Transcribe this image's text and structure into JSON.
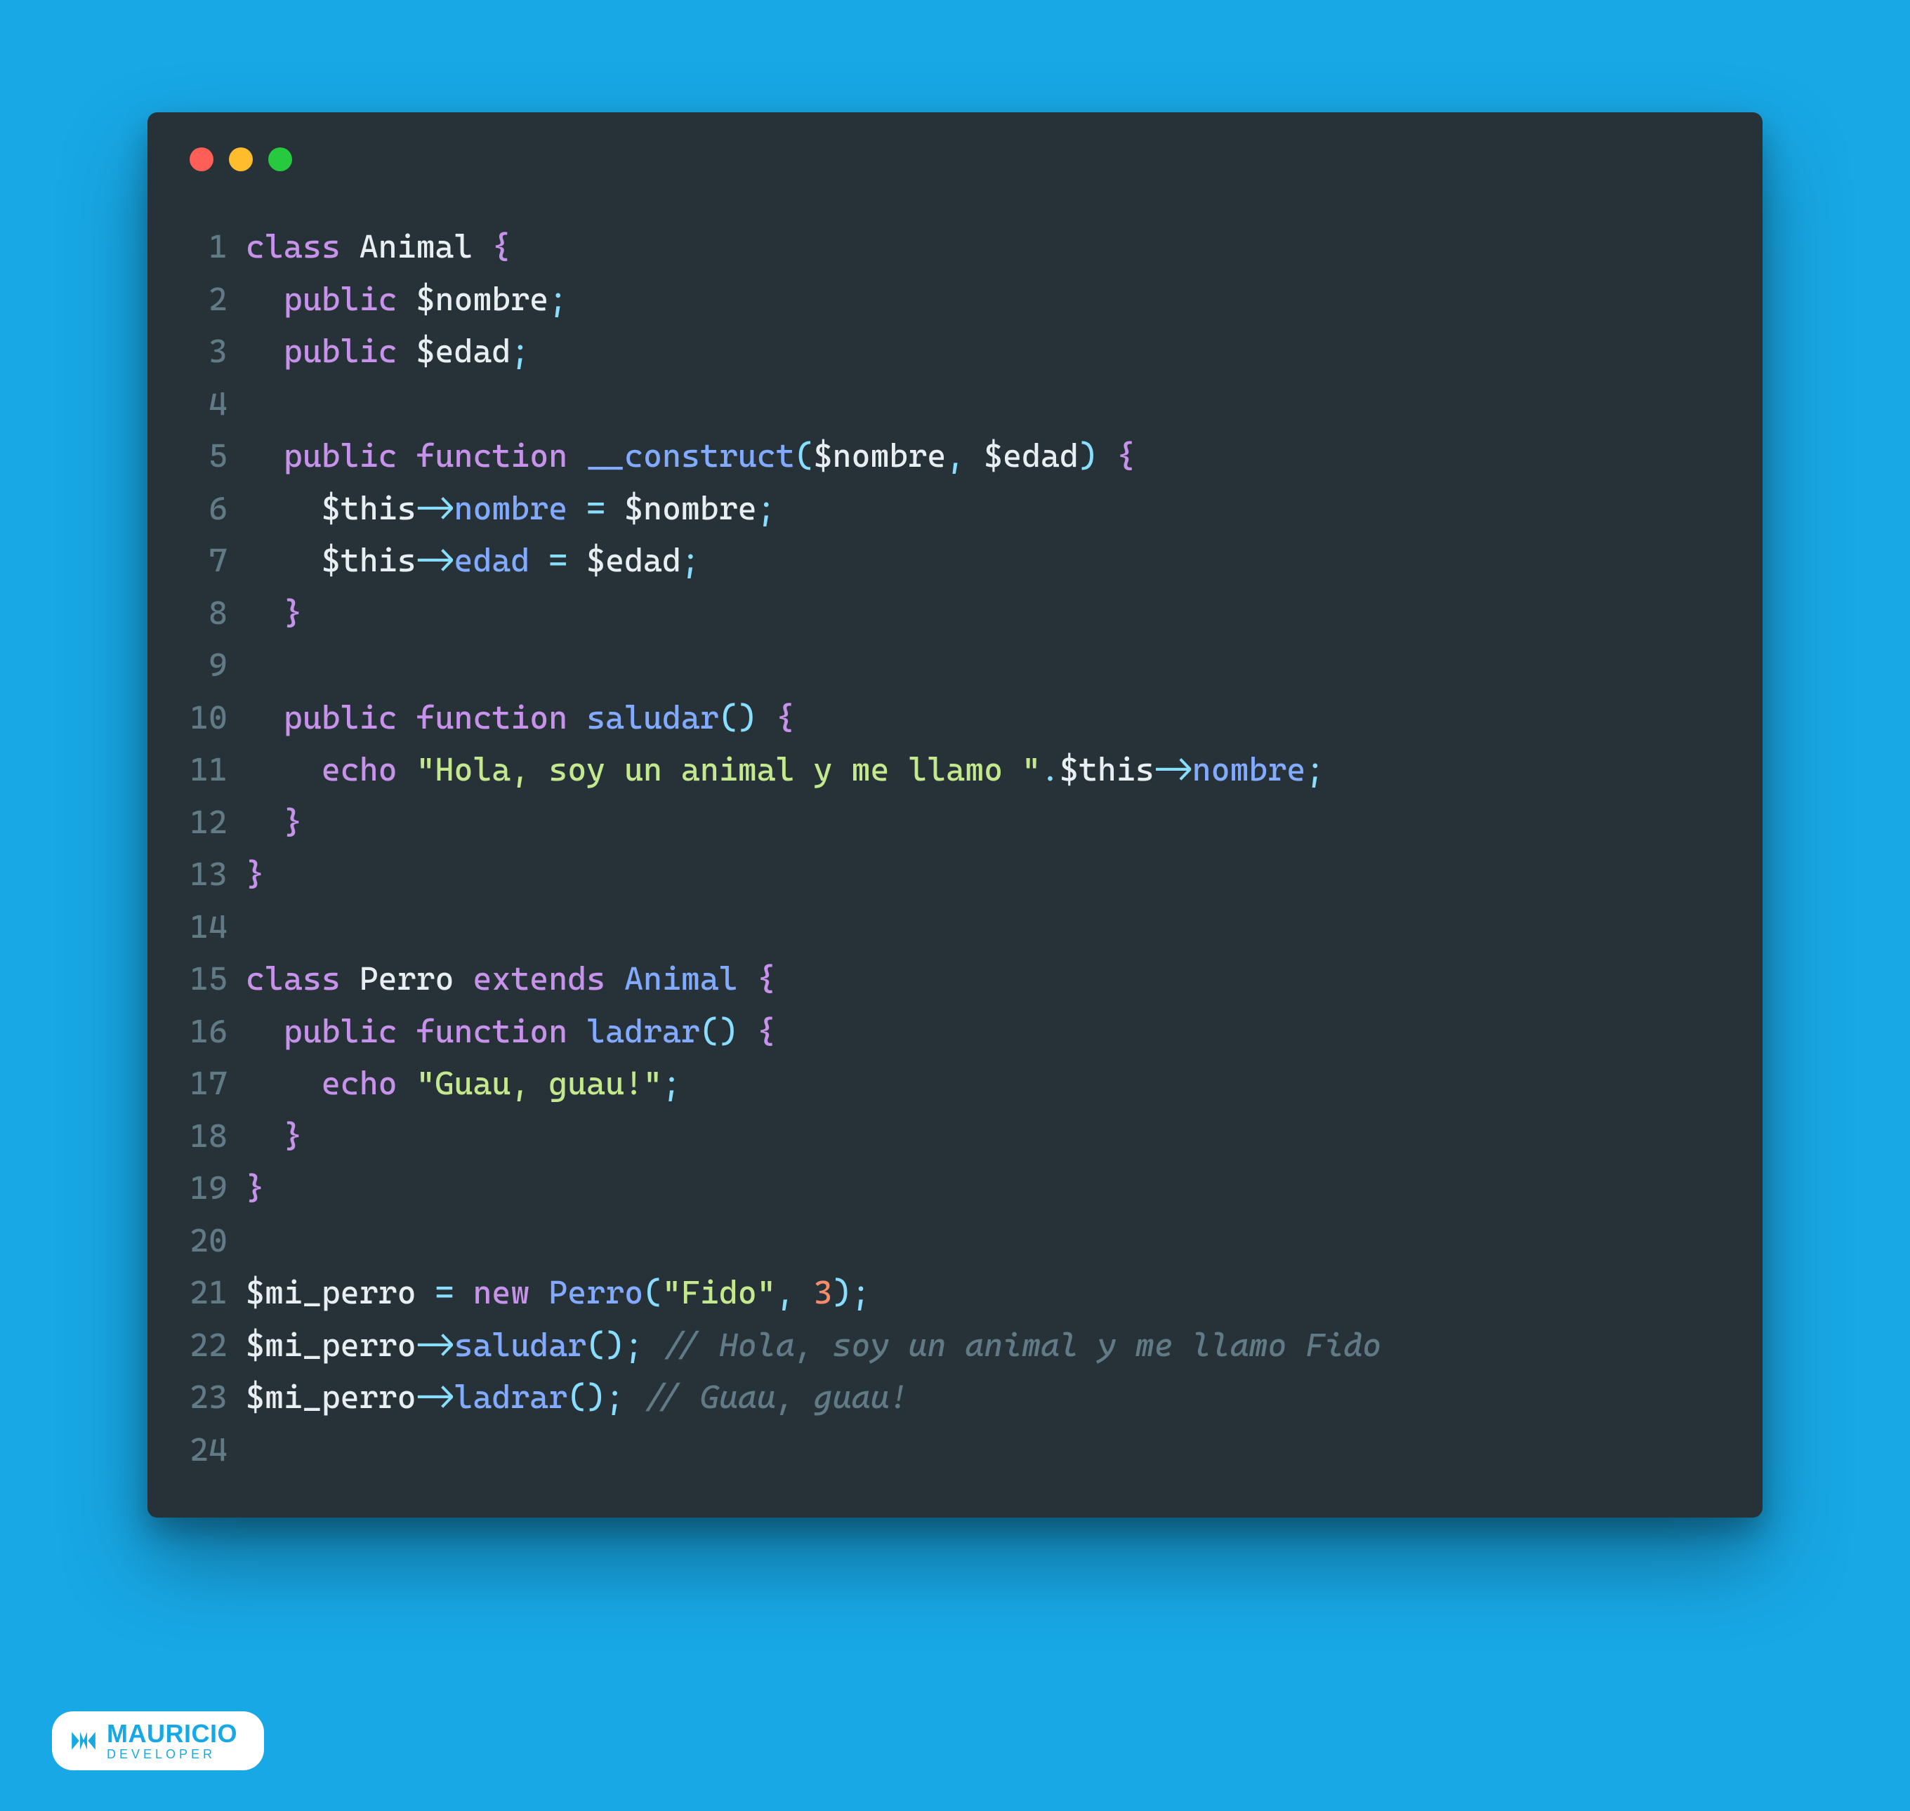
{
  "colors": {
    "bg": "#18a8e6",
    "editor_bg": "#263238"
  },
  "window": {
    "buttons": [
      "close",
      "minimize",
      "maximize"
    ]
  },
  "code": {
    "lines": [
      {
        "n": 1,
        "tokens": [
          [
            "kw",
            "class"
          ],
          [
            "sp",
            " "
          ],
          [
            "cls",
            "Animal"
          ],
          [
            "sp",
            " "
          ],
          [
            "brace",
            "{"
          ]
        ]
      },
      {
        "n": 2,
        "tokens": [
          [
            "sp",
            "  "
          ],
          [
            "kw",
            "public"
          ],
          [
            "sp",
            " "
          ],
          [
            "var",
            "$nombre"
          ],
          [
            "op",
            ";"
          ]
        ]
      },
      {
        "n": 3,
        "tokens": [
          [
            "sp",
            "  "
          ],
          [
            "kw",
            "public"
          ],
          [
            "sp",
            " "
          ],
          [
            "var",
            "$edad"
          ],
          [
            "op",
            ";"
          ]
        ]
      },
      {
        "n": 4,
        "tokens": []
      },
      {
        "n": 5,
        "tokens": [
          [
            "sp",
            "  "
          ],
          [
            "kw",
            "public"
          ],
          [
            "sp",
            " "
          ],
          [
            "kw",
            "function"
          ],
          [
            "sp",
            " "
          ],
          [
            "fn",
            "__construct"
          ],
          [
            "punc",
            "("
          ],
          [
            "var",
            "$nombre"
          ],
          [
            "op",
            ","
          ],
          [
            "sp",
            " "
          ],
          [
            "var",
            "$edad"
          ],
          [
            "punc",
            ")"
          ],
          [
            "sp",
            " "
          ],
          [
            "brace",
            "{"
          ]
        ]
      },
      {
        "n": 6,
        "tokens": [
          [
            "sp",
            "    "
          ],
          [
            "this",
            "$this"
          ],
          [
            "op",
            "->"
          ],
          [
            "prop",
            "nombre"
          ],
          [
            "sp",
            " "
          ],
          [
            "op",
            "="
          ],
          [
            "sp",
            " "
          ],
          [
            "var",
            "$nombre"
          ],
          [
            "op",
            ";"
          ]
        ]
      },
      {
        "n": 7,
        "tokens": [
          [
            "sp",
            "    "
          ],
          [
            "this",
            "$this"
          ],
          [
            "op",
            "->"
          ],
          [
            "prop",
            "edad"
          ],
          [
            "sp",
            " "
          ],
          [
            "op",
            "="
          ],
          [
            "sp",
            " "
          ],
          [
            "var",
            "$edad"
          ],
          [
            "op",
            ";"
          ]
        ]
      },
      {
        "n": 8,
        "tokens": [
          [
            "sp",
            "  "
          ],
          [
            "brace",
            "}"
          ]
        ]
      },
      {
        "n": 9,
        "tokens": []
      },
      {
        "n": 10,
        "tokens": [
          [
            "sp",
            "  "
          ],
          [
            "kw",
            "public"
          ],
          [
            "sp",
            " "
          ],
          [
            "kw",
            "function"
          ],
          [
            "sp",
            " "
          ],
          [
            "fn",
            "saludar"
          ],
          [
            "punc",
            "("
          ],
          [
            "punc",
            ")"
          ],
          [
            "sp",
            " "
          ],
          [
            "brace",
            "{"
          ]
        ]
      },
      {
        "n": 11,
        "tokens": [
          [
            "sp",
            "    "
          ],
          [
            "kw",
            "echo"
          ],
          [
            "sp",
            " "
          ],
          [
            "str",
            "\"Hola, soy un animal y me llamo \""
          ],
          [
            "op",
            "."
          ],
          [
            "this",
            "$this"
          ],
          [
            "op",
            "->"
          ],
          [
            "prop",
            "nombre"
          ],
          [
            "op",
            ";"
          ]
        ]
      },
      {
        "n": 12,
        "tokens": [
          [
            "sp",
            "  "
          ],
          [
            "brace",
            "}"
          ]
        ]
      },
      {
        "n": 13,
        "tokens": [
          [
            "brace",
            "}"
          ]
        ]
      },
      {
        "n": 14,
        "tokens": []
      },
      {
        "n": 15,
        "tokens": [
          [
            "kw",
            "class"
          ],
          [
            "sp",
            " "
          ],
          [
            "cls",
            "Perro"
          ],
          [
            "sp",
            " "
          ],
          [
            "kw",
            "extends"
          ],
          [
            "sp",
            " "
          ],
          [
            "fn",
            "Animal"
          ],
          [
            "sp",
            " "
          ],
          [
            "brace",
            "{"
          ]
        ]
      },
      {
        "n": 16,
        "tokens": [
          [
            "sp",
            "  "
          ],
          [
            "kw",
            "public"
          ],
          [
            "sp",
            " "
          ],
          [
            "kw",
            "function"
          ],
          [
            "sp",
            " "
          ],
          [
            "fn",
            "ladrar"
          ],
          [
            "punc",
            "("
          ],
          [
            "punc",
            ")"
          ],
          [
            "sp",
            " "
          ],
          [
            "brace",
            "{"
          ]
        ]
      },
      {
        "n": 17,
        "tokens": [
          [
            "sp",
            "    "
          ],
          [
            "kw",
            "echo"
          ],
          [
            "sp",
            " "
          ],
          [
            "str",
            "\"Guau, guau!\""
          ],
          [
            "op",
            ";"
          ]
        ]
      },
      {
        "n": 18,
        "tokens": [
          [
            "sp",
            "  "
          ],
          [
            "brace",
            "}"
          ]
        ]
      },
      {
        "n": 19,
        "tokens": [
          [
            "brace",
            "}"
          ]
        ]
      },
      {
        "n": 20,
        "tokens": []
      },
      {
        "n": 21,
        "tokens": [
          [
            "var",
            "$mi_perro"
          ],
          [
            "sp",
            " "
          ],
          [
            "op",
            "="
          ],
          [
            "sp",
            " "
          ],
          [
            "kw",
            "new"
          ],
          [
            "sp",
            " "
          ],
          [
            "fn",
            "Perro"
          ],
          [
            "punc",
            "("
          ],
          [
            "str",
            "\"Fido\""
          ],
          [
            "op",
            ","
          ],
          [
            "sp",
            " "
          ],
          [
            "num",
            "3"
          ],
          [
            "punc",
            ")"
          ],
          [
            "op",
            ";"
          ]
        ]
      },
      {
        "n": 22,
        "tokens": [
          [
            "var",
            "$mi_perro"
          ],
          [
            "op",
            "->"
          ],
          [
            "fn",
            "saludar"
          ],
          [
            "punc",
            "("
          ],
          [
            "punc",
            ")"
          ],
          [
            "op",
            ";"
          ],
          [
            "sp",
            " "
          ],
          [
            "cmt",
            "// Hola, soy un animal y me llamo Fido"
          ]
        ]
      },
      {
        "n": 23,
        "tokens": [
          [
            "var",
            "$mi_perro"
          ],
          [
            "op",
            "->"
          ],
          [
            "fn",
            "ladrar"
          ],
          [
            "punc",
            "("
          ],
          [
            "punc",
            ")"
          ],
          [
            "op",
            ";"
          ],
          [
            "sp",
            " "
          ],
          [
            "cmt",
            "// Guau, guau!"
          ]
        ]
      },
      {
        "n": 24,
        "tokens": []
      }
    ]
  },
  "badge": {
    "name": "MAURICIO",
    "sub": "DEVELOPER"
  }
}
